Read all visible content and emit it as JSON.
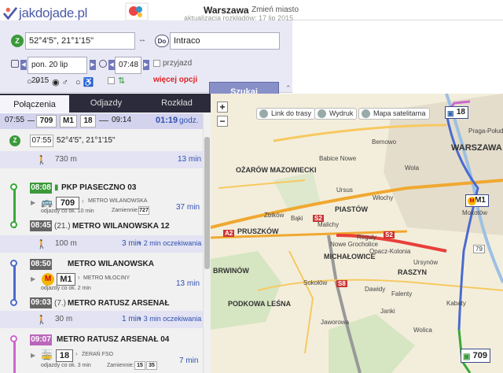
{
  "header": {
    "logo_text": "jakdojade.pl",
    "city": "Warszawa",
    "change_city": "Zmień miasto",
    "update_info": "aktualizacja rozkładów: 17 lip 2015"
  },
  "search": {
    "from_badge": "Z",
    "from_value": "52°4'5\", 21°1'15\"",
    "swap_icon": "swap-icon",
    "to_badge": "Do",
    "to_value": "Intraco",
    "date": "pon. 20 lip 2015",
    "time": "07:48",
    "arrival_label": "przyjazd",
    "more_options": "więcej opcji",
    "search_button": "Szukaj"
  },
  "tabs": [
    "Połączenia",
    "Odjazdy",
    "Rozkład"
  ],
  "summary": {
    "start": "07:55",
    "lines": [
      "709",
      "M1",
      "18"
    ],
    "end": "09:14",
    "duration": "01:19",
    "duration_unit": "godz."
  },
  "route": {
    "start_badge": "Z",
    "start_time": "07:55",
    "start_place": "52°4'5\", 21°1'15\"",
    "walk1_dist": "730 m",
    "walk1_time": "13 min",
    "seg1": {
      "dep_time": "08:08",
      "dep_stop": "PKP PIASECZNO 03",
      "line": "709",
      "direction": "METRO WILANOWSKA",
      "freq": "odjazdy co ok. 10 min",
      "alt_label": "Zamiennie:",
      "alt_line": "727",
      "duration": "37 min",
      "arr_time": "08:45",
      "arr_stop_count": "(21.)",
      "arr_stop": "METRO WILANOWSKA 12"
    },
    "walk2_dist": "100 m",
    "walk2_time": "3 min",
    "walk2_wait": "+ 2 min oczekiwania",
    "seg2": {
      "dep_time": "08:50",
      "dep_stop": "METRO WILANOWSKA",
      "line": "M1",
      "direction": "METRO MŁOCINY",
      "freq": "odjazdy co ok. 2 min",
      "duration": "13 min",
      "arr_time": "09:03",
      "arr_stop_count": "(7.)",
      "arr_stop": "METRO RATUSZ ARSENAŁ"
    },
    "walk3_dist": "30 m",
    "walk3_time": "1 min",
    "walk3_wait": "+ 3 min oczekiwania",
    "seg3": {
      "dep_time": "09:07",
      "dep_stop": "METRO RATUSZ ARSENAŁ 04",
      "line": "18",
      "direction": "ŻERAŃ FSO",
      "freq": "odjazdy co ok. 3 min",
      "alt_label": "Zamiennie:",
      "alt_lines": [
        "15",
        "35"
      ],
      "duration": "7 min"
    }
  },
  "map": {
    "toolbar": [
      "Link do trasy",
      "Wydruk",
      "Mapa satelitarna"
    ],
    "zoom_in": "+",
    "zoom_out": "−",
    "labels": {
      "warszawa": "WARSZAWA",
      "praga": "Praga-Południe",
      "mokotow": "Mokotów",
      "wola": "Wola",
      "ozarow": "OŻARÓW MAZOWIECKI",
      "pruszkow": "PRUSZKÓW",
      "piastow": "PIASTÓW",
      "ursus": "Ursus",
      "wlochy": "Włochy",
      "michalowice": "MICHAŁOWICE",
      "brwinow": "BRWINÓW",
      "podkowa": "PODKOWA LEŚNA",
      "raszyn": "RASZYN",
      "janki": "Janki",
      "nowe_grocholice": "Nowe Grocholice",
      "bemowo": "Bemowo",
      "babice": "Babice Nowe",
      "ursynow": "Ursynów",
      "zbikow": "Żbików",
      "baki": "Bąki",
      "reguly": "Reguły",
      "malichy": "Malichy",
      "opacz": "Opacz-Kolonia",
      "sokolow": "Sokołów",
      "dawidy": "Dawidy",
      "jaworowa": "Jaworowa",
      "falenty": "Falenty",
      "wolica": "Wolica",
      "kabaty": "Kabaty"
    },
    "road_labels": [
      "A2",
      "S2",
      "S2",
      "S8",
      "79"
    ],
    "marker_lines": [
      "18",
      "M1",
      "709"
    ],
    "colors": {
      "route_line1": "#3aa83a",
      "route_line2": "#4a6ad0",
      "route_line3": "#cc66cc"
    }
  }
}
